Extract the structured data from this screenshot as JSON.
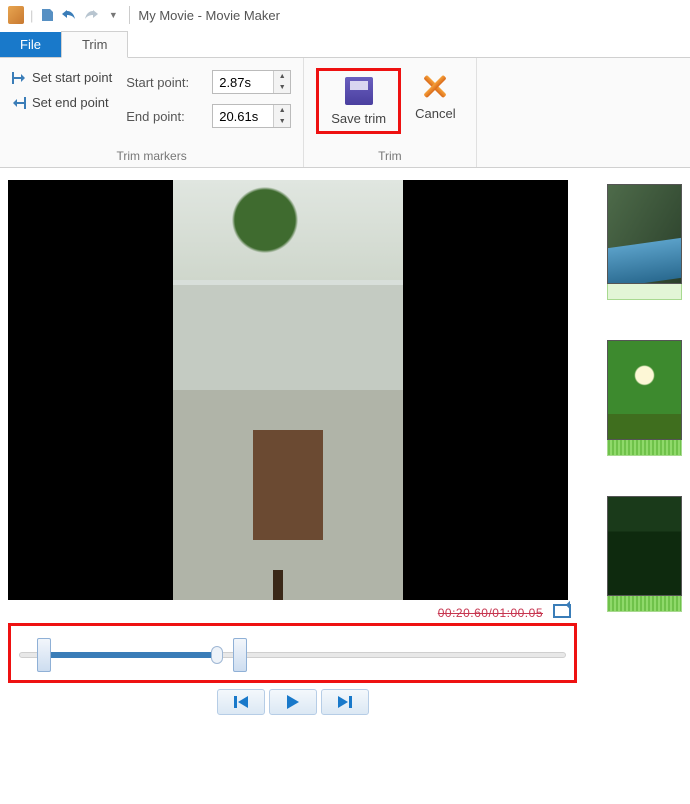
{
  "title": "My Movie - Movie Maker",
  "tabs": {
    "file": "File",
    "trim": "Trim"
  },
  "ribbon": {
    "set_start": "Set start point",
    "set_end": "Set end point",
    "start_label": "Start point:",
    "end_label": "End point:",
    "start_value": "2.87s",
    "end_value": "20.61s",
    "group_markers": "Trim markers",
    "save_trim": "Save trim",
    "cancel": "Cancel",
    "group_trim": "Trim"
  },
  "preview": {
    "timestamp": "00:20.60/01:00.05"
  }
}
